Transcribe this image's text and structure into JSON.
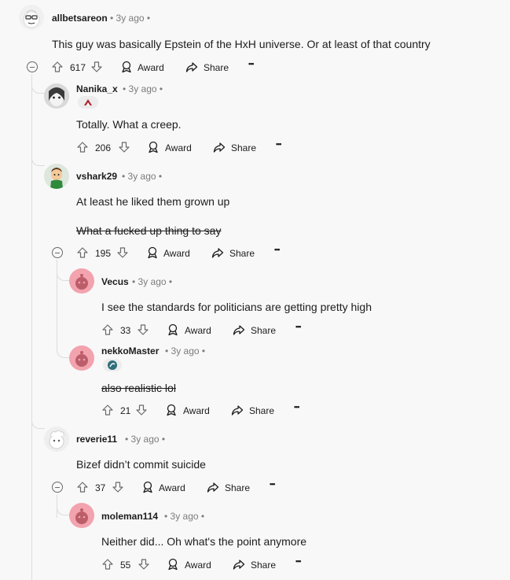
{
  "comments": [
    {
      "username": "allbetsareon",
      "meta": "• 3y ago •",
      "text": "This guy was basically Epstein of the HxH universe. Or at least of that country",
      "votes": "617",
      "award": "Award",
      "share": "Share",
      "more": "•••"
    },
    {
      "username": "Nanika_x",
      "meta": "• 3y ago •",
      "text": "Totally. What a creep.",
      "votes": "206",
      "award": "Award",
      "share": "Share",
      "more": "•••"
    },
    {
      "username": "vshark29",
      "meta": "• 3y ago •",
      "text": "At least he liked them grown up",
      "text2": "What a fucked up thing to say",
      "votes": "195",
      "award": "Award",
      "share": "Share",
      "more": "•••"
    },
    {
      "username": "Vecus",
      "meta": "• 3y ago •",
      "text": "I see the standards for politicians are getting pretty high",
      "votes": "33",
      "award": "Award",
      "share": "Share",
      "more": "•••"
    },
    {
      "username": "nekkoMaster",
      "meta": "• 3y ago •",
      "text": "also realistic lol",
      "votes": "21",
      "award": "Award",
      "share": "Share",
      "more": "•••"
    },
    {
      "username": "reverie11",
      "meta": "• 3y ago •",
      "text": "Bizef didn’t commit suicide",
      "votes": "37",
      "award": "Award",
      "share": "Share",
      "more": "•••"
    },
    {
      "username": "moleman114",
      "meta": "• 3y ago •",
      "text": "Neither did... Oh what's the point anymore",
      "votes": "55",
      "award": "Award",
      "share": "Share",
      "more": "•••"
    }
  ],
  "colors": {
    "background": "#f8f8f8",
    "thread_line": "#dcdcdc",
    "text": "#1c1c1c",
    "meta": "#7c7c7c",
    "default_avatar_bg": "#f2a3ae"
  },
  "icons": {
    "upvote": "upvote-icon",
    "downvote": "downvote-icon",
    "award": "award-icon",
    "share": "share-icon",
    "collapse": "collapse-icon"
  }
}
